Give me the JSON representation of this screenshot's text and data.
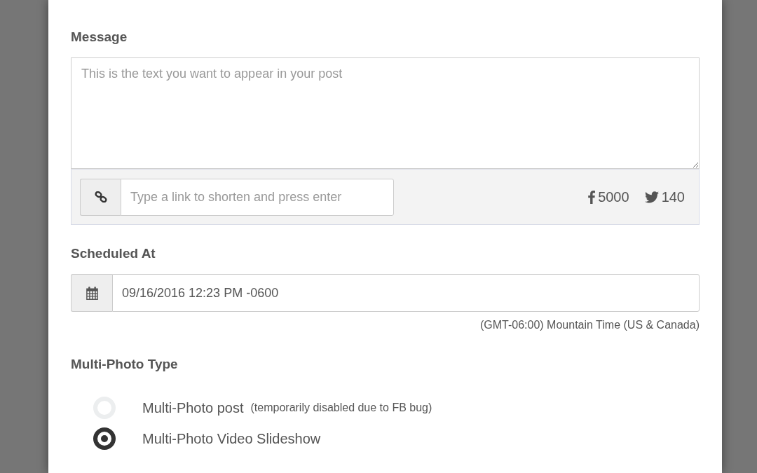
{
  "message": {
    "label": "Message",
    "placeholder": "This is the text you want to appear in your post",
    "link_field": {
      "placeholder": "Type a link to shorten and press enter"
    },
    "counters": [
      {
        "kind": "facebook",
        "value": "5000"
      },
      {
        "kind": "twitter",
        "value": "140"
      }
    ]
  },
  "scheduled_at": {
    "label": "Scheduled At",
    "value": "09/16/2016 12:23 PM -0600",
    "timezone": "(GMT-06:00) Mountain Time (US & Canada)"
  },
  "multi_photo_type": {
    "label": "Multi-Photo Type",
    "options": [
      {
        "label": "Multi-Photo post",
        "note": "(temporarily disabled due to FB bug)",
        "selected": false,
        "disabled": true
      },
      {
        "label": "Multi-Photo Video Slideshow",
        "selected": true,
        "disabled": false
      }
    ]
  }
}
